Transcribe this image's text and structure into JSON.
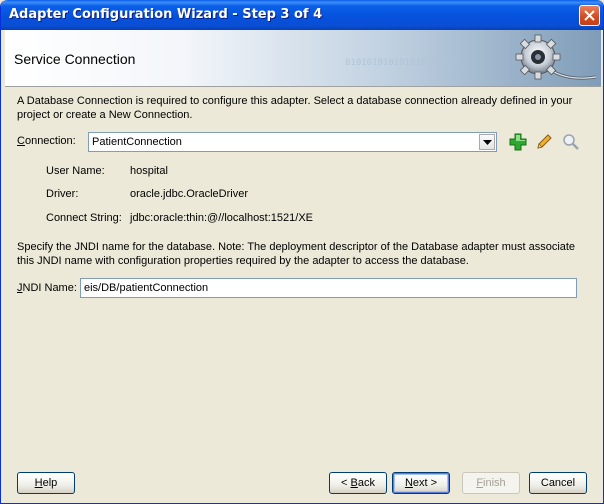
{
  "window": {
    "title": "Adapter Configuration Wizard - Step 3 of 4"
  },
  "header": {
    "heading": "Service Connection",
    "decoration": "010101010101010101010"
  },
  "main": {
    "description": "A Database Connection is required to configure this adapter. Select a database connection already defined in your project or create a New Connection.",
    "connection_label_mnemonic": "C",
    "connection_label_rest": "onnection:",
    "connection_value": "PatientConnection",
    "details": [
      {
        "label": "User Name:",
        "value": "hospital"
      },
      {
        "label": "Driver:",
        "value": "oracle.jdbc.OracleDriver"
      },
      {
        "label": "Connect String:",
        "value": "jdbc:oracle:thin:@//localhost:1521/XE"
      }
    ],
    "jndi_note": "Specify the JNDI name for the database.  Note: The deployment descriptor of the Database adapter must associate this JNDI name with configuration properties required by the adapter to access the database.",
    "jndi_label_mnemonic": "J",
    "jndi_label_rest": "NDI Name:",
    "jndi_value": "eis/DB/patientConnection"
  },
  "footer": {
    "help_mnemonic": "H",
    "help_rest": "elp",
    "back_prefix": "< ",
    "back_mnemonic": "B",
    "back_rest": "ack",
    "next_mnemonic": "N",
    "next_rest": "ext >",
    "finish_mnemonic": "F",
    "finish_rest": "inish",
    "cancel_label": "Cancel"
  },
  "colors": {
    "titlebar": "#0a5fe8",
    "add_icon": "#2fa82f",
    "edit_icon": "#e0a020"
  }
}
